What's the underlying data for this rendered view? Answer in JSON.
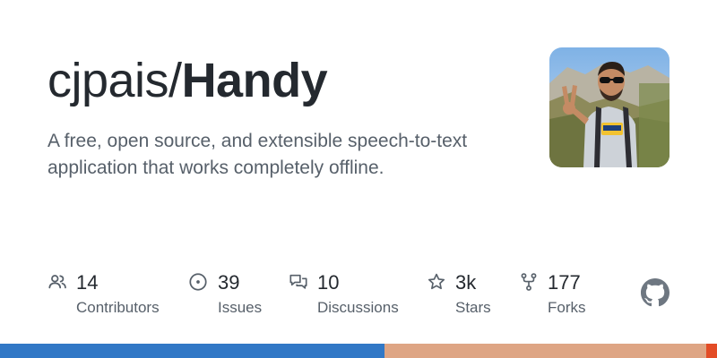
{
  "repo": {
    "owner": "cjpais/",
    "name": "Handy",
    "description": "A free, open source, and extensible speech-to-text application that works completely offline."
  },
  "stats": [
    {
      "icon": "people-icon",
      "count": "14",
      "label": "Contributors"
    },
    {
      "icon": "issue-icon",
      "count": "39",
      "label": "Issues"
    },
    {
      "icon": "discussions-icon",
      "count": "10",
      "label": "Discussions"
    },
    {
      "icon": "star-icon",
      "count": "3k",
      "label": "Stars"
    },
    {
      "icon": "fork-icon",
      "count": "177",
      "label": "Forks"
    }
  ],
  "languages": [
    {
      "color": "#3178c6",
      "fraction": 0.536
    },
    {
      "color": "#dea584",
      "fraction": 0.449
    },
    {
      "color": "#e34c26",
      "fraction": 0.015
    }
  ],
  "colors": {
    "title": "#24292f",
    "muted": "#57606a",
    "icon": "#57606a"
  }
}
